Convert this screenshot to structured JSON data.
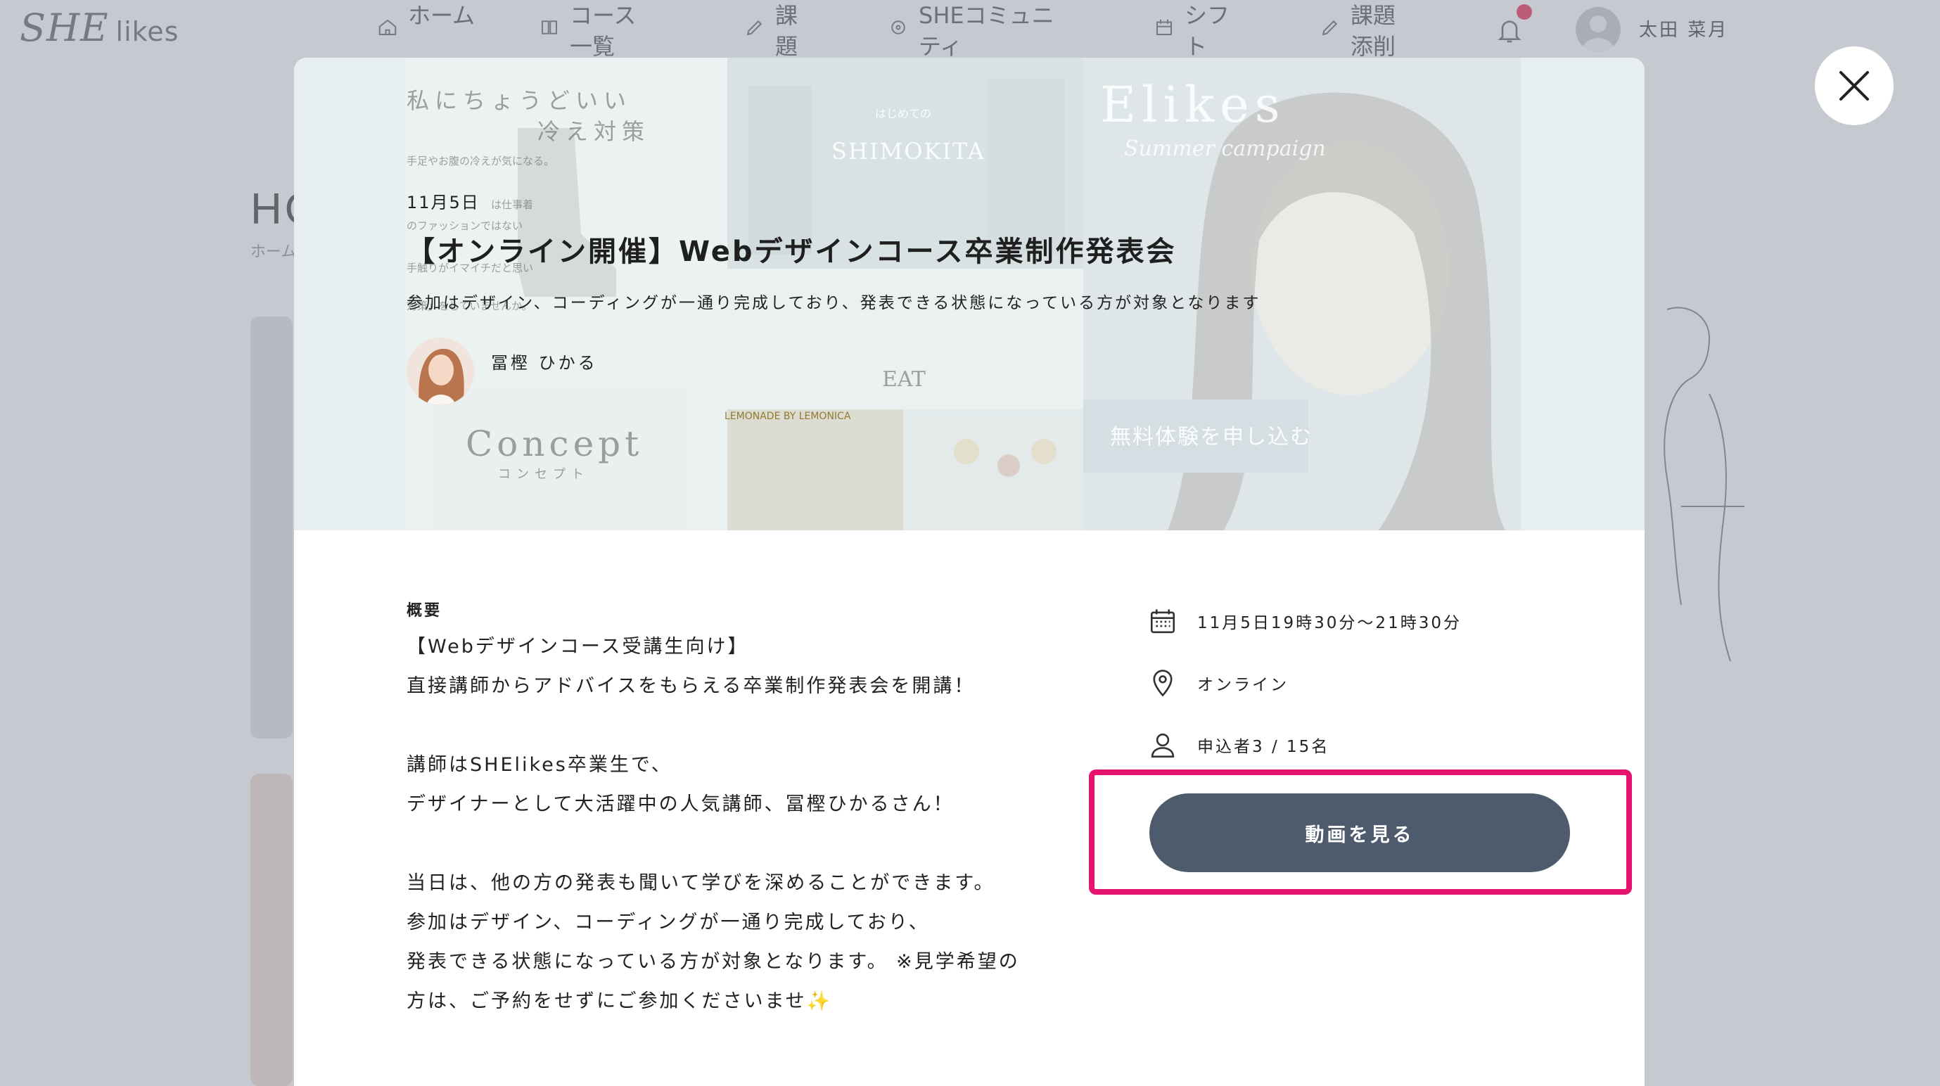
{
  "brand": {
    "logo_main": "SHE",
    "logo_sub": "likes"
  },
  "nav": {
    "items": [
      {
        "label": "ホーム",
        "icon": "home-icon"
      },
      {
        "label": "コース一覧",
        "icon": "book-icon"
      },
      {
        "label": "課題",
        "icon": "pencil-icon"
      },
      {
        "label": "SHEコミュニティ",
        "icon": "community-icon"
      },
      {
        "label": "シフト",
        "icon": "calendar-icon"
      },
      {
        "label": "課題添削",
        "icon": "edit-icon"
      }
    ],
    "user_name": "太田 菜月"
  },
  "background_page": {
    "title": "HO",
    "breadcrumb": "ホーム"
  },
  "hero_deco": {
    "p1_title_1": "私にちょうどいい",
    "p1_title_2": "冷え対策",
    "p1_lines": [
      "手足やお腹の冷えが気になる。",
      "は仕事着",
      "のファッションではない",
      "手触りがイマイチだと思い",
      "対策」をしていませんか。"
    ],
    "p1_concept": "Concept",
    "p1_concept_kana": "コンセプト",
    "p2_small": "はじめての",
    "p2_title": "SHIMOKITA",
    "p2_eat": "EAT",
    "p2_shop": "LEMONADE BY LEMONICA",
    "p3_title": "Elikes",
    "p3_script": "Summer campaign",
    "p3_btn": "無料体験を申し込む"
  },
  "event": {
    "date": "11月5日",
    "title": "【オンライン開催】Webデザインコース卒業制作発表会",
    "subtitle": "参加はデザイン、コーディングが一通り完成しており、発表できる状態になっている方が対象となります",
    "lecturer": "冨樫 ひかる",
    "summary_label": "概要",
    "description": [
      "【Webデザインコース受講生向け】",
      "直接講師からアドバイスをもらえる卒業制作発表会を開講！",
      "",
      "講師はSHElikes卒業生で、",
      "デザイナーとして大活躍中の人気講師、冨樫ひかるさん！",
      "",
      "当日は、他の方の発表も聞いて学びを深めることができます。",
      "参加はデザイン、コーディングが一通り完成しており、",
      "発表できる状態になっている方が対象となります。 ※見学希望の",
      "方は、ご予約をせずにご参加くださいませ✨"
    ],
    "datetime": "11月5日19時30分〜21時30分",
    "location": "オンライン",
    "applicants": "申込者3 / 15名",
    "watch_button": "動画を見る"
  },
  "colors": {
    "button": "#4e5b6c",
    "highlight": "#e6146f",
    "notification": "#e5466a"
  }
}
